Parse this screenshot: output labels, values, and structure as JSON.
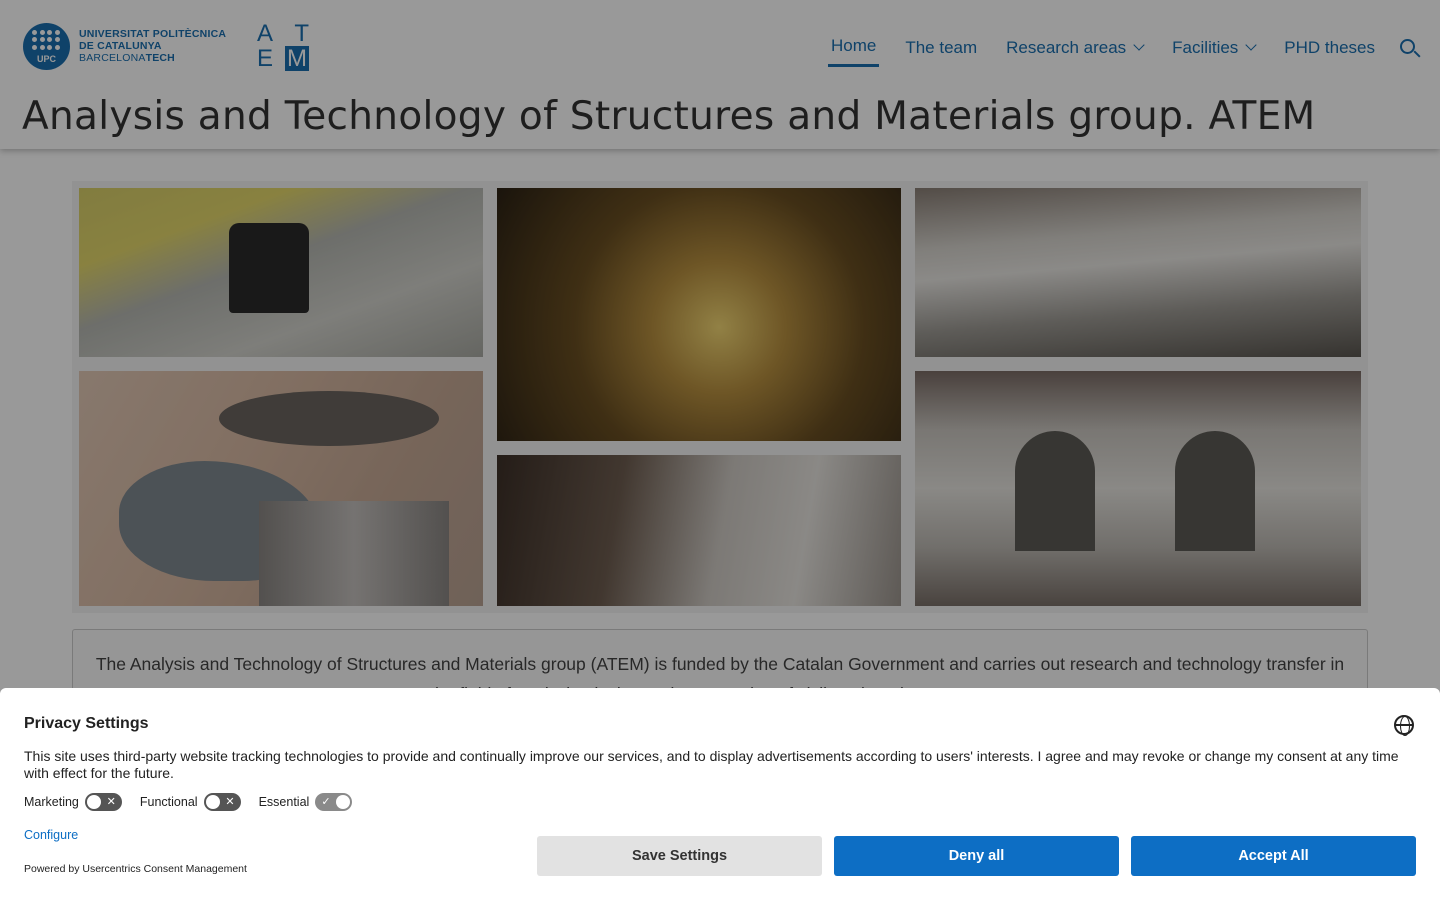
{
  "header": {
    "upc_logo": {
      "line1": "UNIVERSITAT POLITÈCNICA",
      "line2": "DE CATALUNYA",
      "line3_light": "BARCELONA",
      "line3_bold": "TECH",
      "circle_text": "UPC"
    },
    "atem_logo": {
      "a": "A",
      "t": "T",
      "e": "E",
      "m": "M"
    },
    "nav": [
      {
        "label": "Home",
        "active": true
      },
      {
        "label": "The team"
      },
      {
        "label": "Research areas",
        "has_dropdown": true
      },
      {
        "label": "Facilities",
        "has_dropdown": true
      },
      {
        "label": "PHD theses"
      }
    ],
    "search_icon": "search-icon",
    "page_title": "Analysis and Technology of Structures and Materials group. ATEM"
  },
  "intro": {
    "text": "The Analysis and Technology of Structures and Materials group (ATEM) is funded by the Catalan Government and carries out research and technology transfer in the field of analysis, design and construction of civil engineering structures."
  },
  "consent": {
    "title": "Privacy Settings",
    "globe_icon": "globe-icon",
    "text": "This site uses third-party website tracking technologies to provide and continually improve our services, and to display advertisements according to users' interests. I agree and may revoke or change my consent at any time with effect for the future.",
    "toggles": [
      {
        "label": "Marketing",
        "on": false
      },
      {
        "label": "Functional",
        "on": false
      },
      {
        "label": "Essential",
        "on": true
      }
    ],
    "configure_label": "Configure",
    "powered_by": "Powered by Usercentrics Consent Management",
    "buttons": {
      "save": "Save Settings",
      "deny": "Deny all",
      "accept": "Accept All"
    }
  },
  "colors": {
    "brand_blue": "#1a6fb0",
    "button_blue": "#0d6ec4",
    "overlay": "rgba(0,0,0,0.4)"
  }
}
